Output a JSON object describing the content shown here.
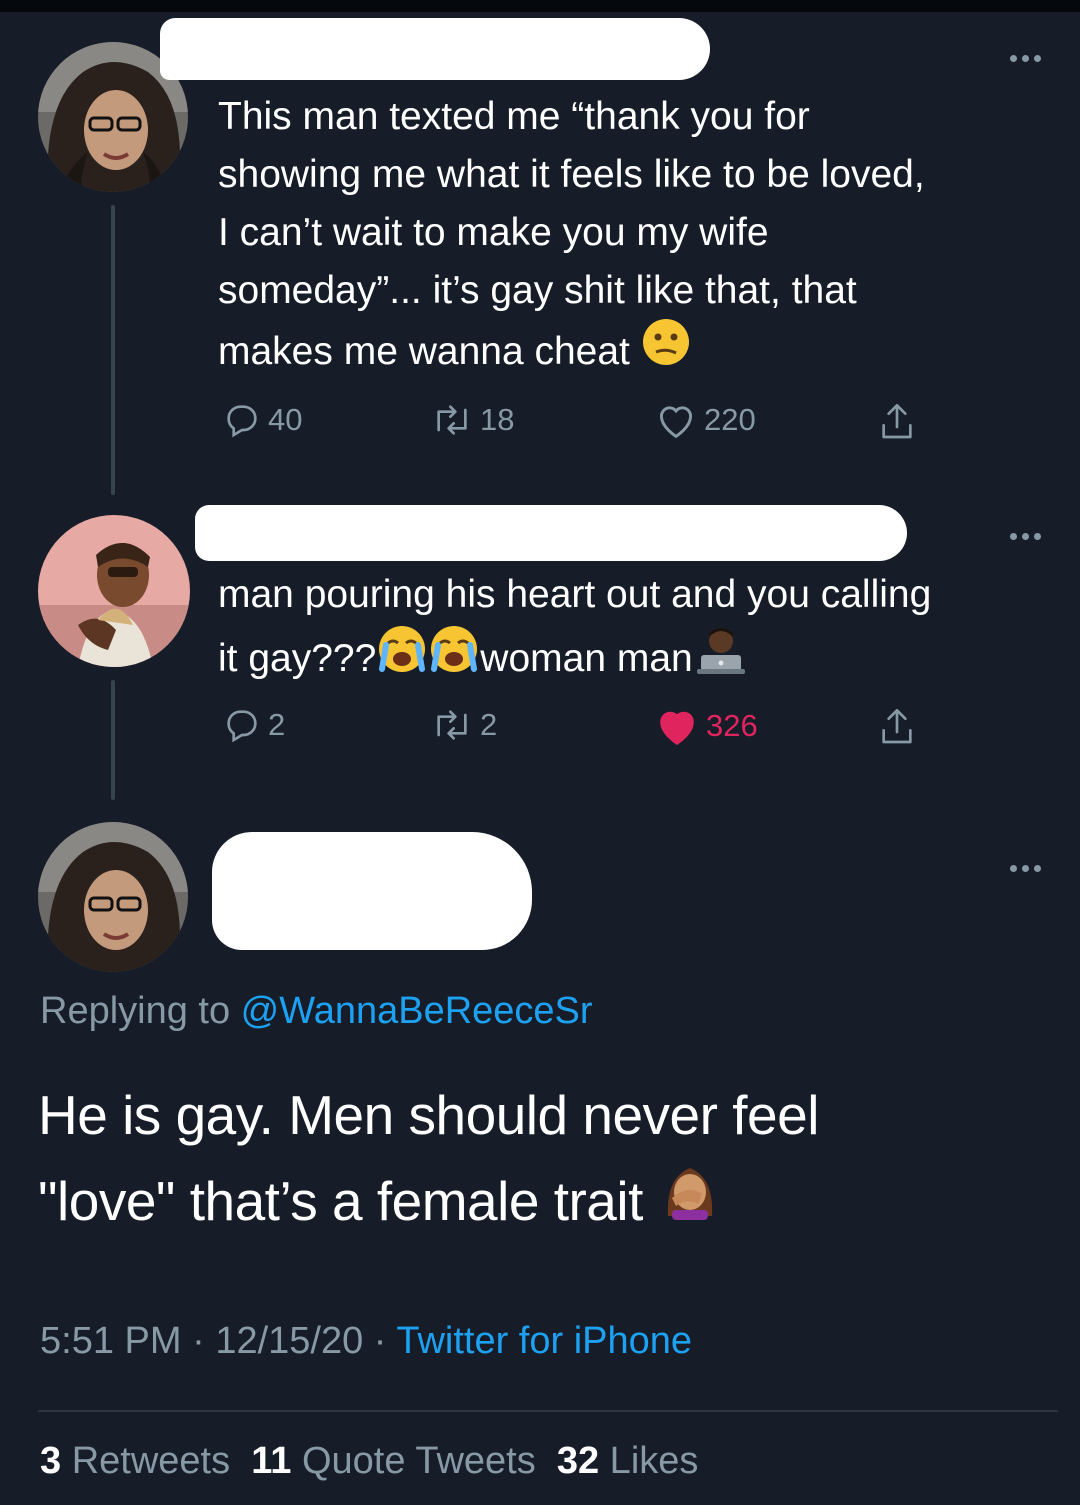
{
  "colors": {
    "background": "#15202b",
    "text_primary": "#ffffff",
    "text_secondary": "#8899a6",
    "link": "#1da1f2",
    "like_active": "#e0245e"
  },
  "tweets": [
    {
      "text": "This man texted me “thank you for\nshowing me what it feels like to be loved,\nI can’t wait to make you my wife\nsomeday”... it’s gay shit like that, that\nmakes me wanna cheat",
      "emoji": "confused-face",
      "reply_count": "40",
      "retweet_count": "18",
      "like_count": "220",
      "liked": false
    },
    {
      "text_line1": "man pouring his heart out and you calling",
      "text_line2a": "it gay???",
      "text_line2b": "woman man",
      "emojis": [
        "loudly-crying-face",
        "loudly-crying-face",
        "man-technologist"
      ],
      "reply_count": "2",
      "retweet_count": "2",
      "like_count": "326",
      "liked": true
    }
  ],
  "main_tweet": {
    "replying_prefix": "Replying to ",
    "replying_handle": "@WannaBeReeceSr",
    "text_line1": "He is gay. Men should never feel",
    "text_line2": "\"love\" that’s a female trait",
    "emoji": "woman-facepalming",
    "time": "5:51 PM",
    "sep1": " · ",
    "date": "12/15/20",
    "sep2": " · ",
    "source": "Twitter for iPhone",
    "retweets_count": "3",
    "retweets_label": " Retweets  ",
    "quotes_count": "11",
    "quotes_label": " Quote Tweets  ",
    "likes_count": "32",
    "likes_label": " Likes"
  }
}
